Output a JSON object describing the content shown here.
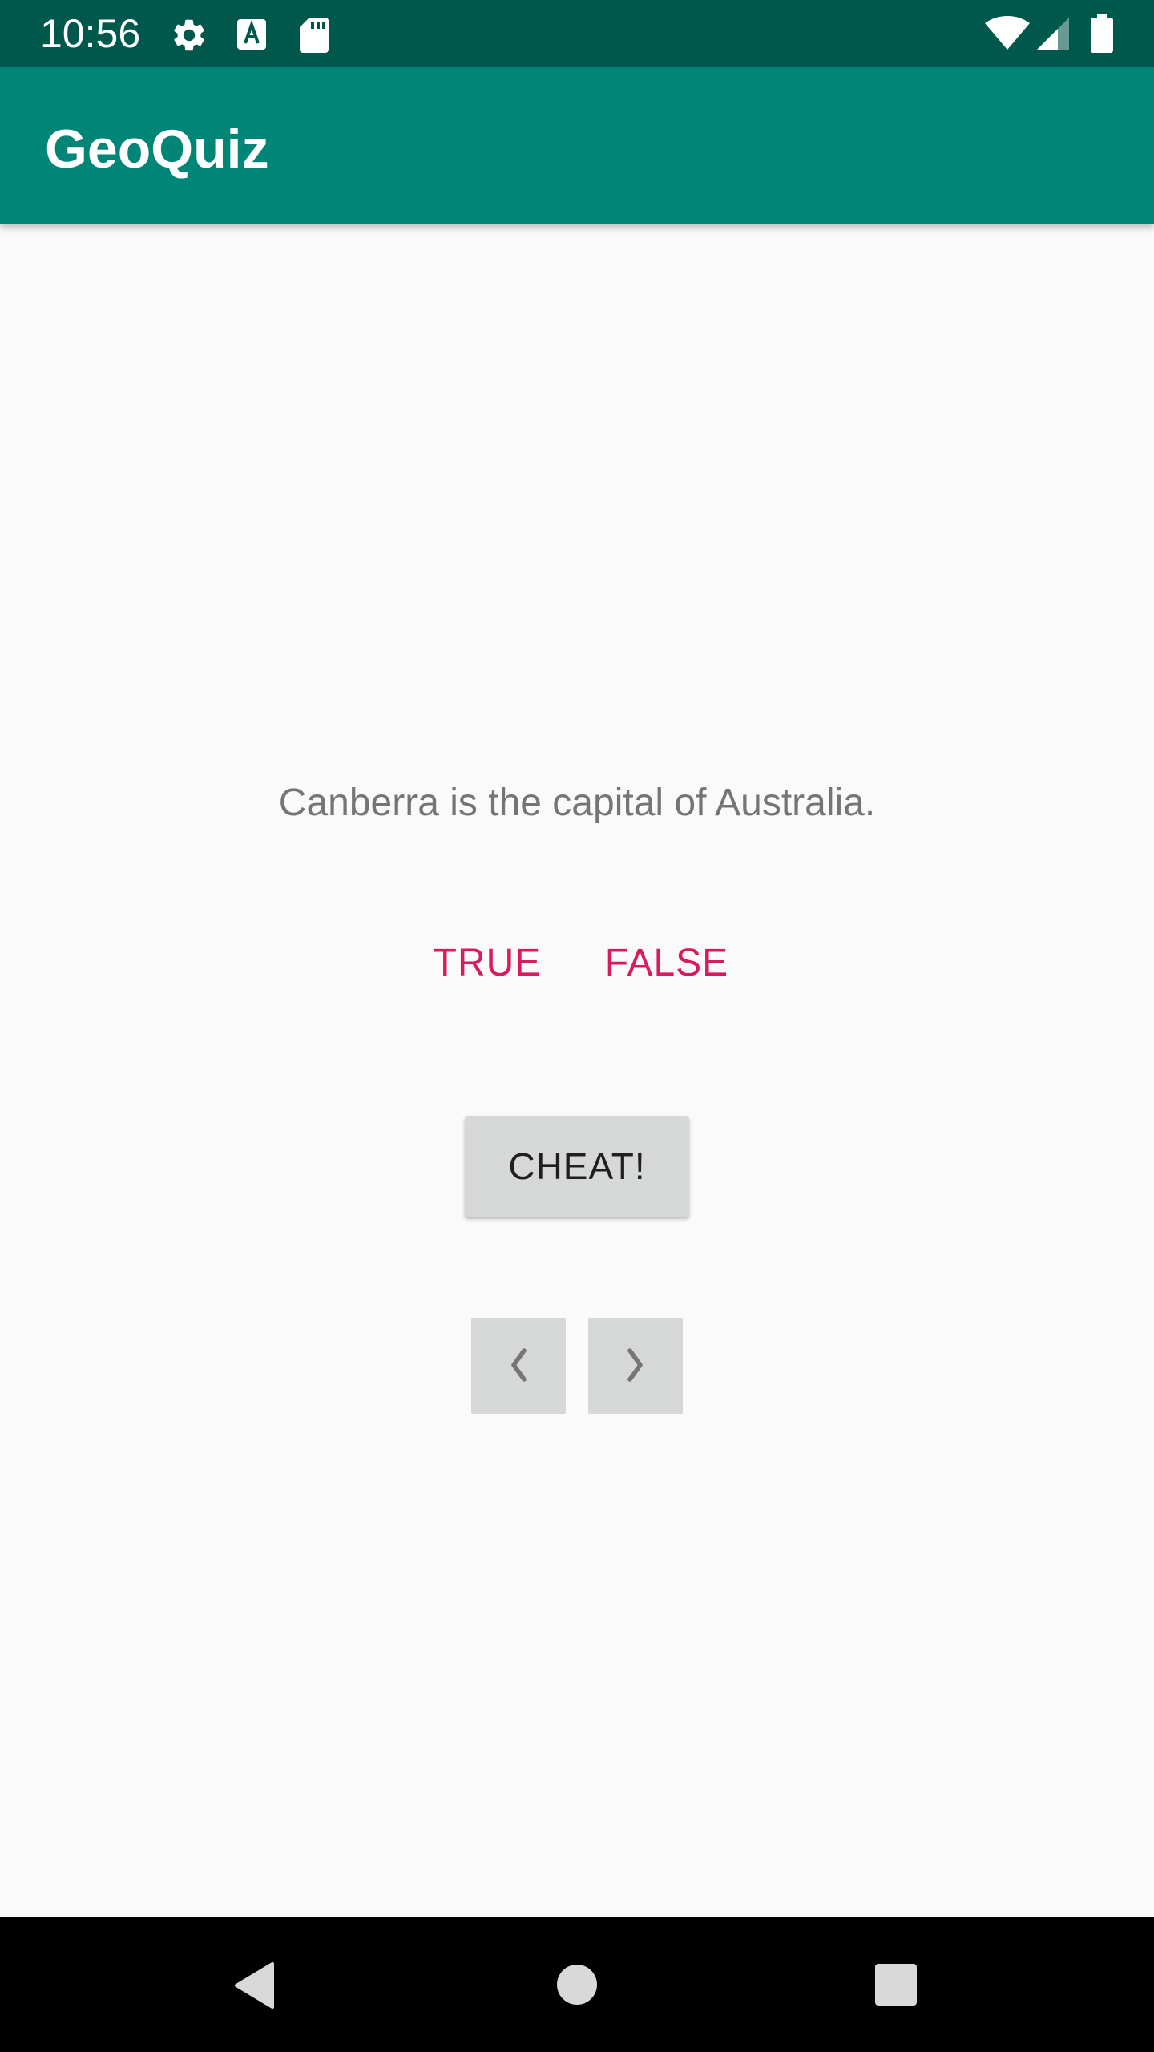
{
  "status_bar": {
    "time": "10:56",
    "icons": [
      "gear-icon",
      "font-a-icon",
      "sd-card-icon",
      "wifi-icon",
      "cell-signal-icon",
      "battery-icon"
    ]
  },
  "app_bar": {
    "title": "GeoQuiz"
  },
  "quiz": {
    "question": "Canberra is the capital of Australia.",
    "true_label": "TRUE",
    "false_label": "FALSE",
    "cheat_label": "CHEAT!",
    "prev_icon": "chevron-left-icon",
    "next_icon": "chevron-right-icon"
  },
  "nav_bar": {
    "keys": [
      "back-icon",
      "home-icon",
      "recents-icon"
    ]
  },
  "colors": {
    "status_bar": "#00574b",
    "app_bar": "#008577",
    "accent": "#d81b60",
    "background": "#fafafa",
    "button_grey": "#d6d7d7",
    "question_text": "#757575"
  }
}
